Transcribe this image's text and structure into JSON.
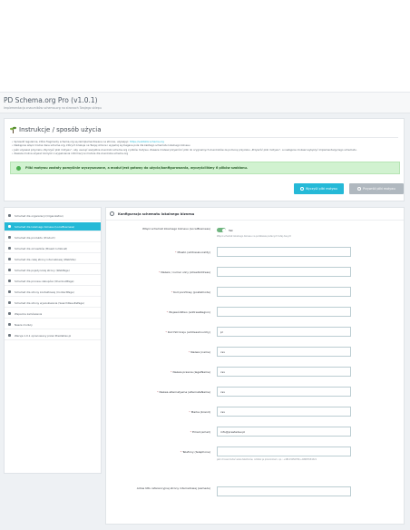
{
  "header": {
    "title": "PD Schema.org Pro (v1.0.1)",
    "subtitle": "Implementacja znaczników schema.org na stronach Twojego sklepu"
  },
  "instructions": {
    "title": "Instrukcje / sposób użycia",
    "items": [
      {
        "text": "Sprawdź regularnie, które fragmenty schema.org są zaimplementowane na stronie, używając: ",
        "link": "https://validator.schema.org"
      },
      {
        "text": "Następnie włącz można dane schema.org, których brakuje na Twojej stronie i wypełnij wymagane pola dla każdego schematu lokalnego biznesu",
        "link": ""
      },
      {
        "text": "Jeśli używasz przycisku „Wyczyść pliki motywu”, aby usunąć wszystkie znaczniki schema.org z plików motywu. Zawsze możesz przywrócić pliki do oryginalnych znaczników za pomocą przycisku „Przywróć pliki motywu”, a następnie możesz wyłączyć implementację tego schematu.",
        "link": ""
      },
      {
        "text": "Zawsze można używać korzyści z wypełnienia informacji w module dla znacznika schema.org",
        "link": ""
      }
    ]
  },
  "alert": {
    "text": "Pliki motywu zostały pomyślnie wyczyszczone, a moduł jest gotowy do użycia/konfigurowania, wyczyściliśmy 6 plików szablonu."
  },
  "buttons": {
    "clear": "Wyczyść pliki motywu",
    "restore": "Przywróć pliki motywu"
  },
  "sidebar": {
    "items": [
      {
        "label": "Schemat dla organizacji (Organization)",
        "active": false
      },
      {
        "label": "Schemat dla lokalnego biznesu (LocalBusiness)",
        "active": true
      },
      {
        "label": "Schemat dla produktu (Product)",
        "active": false
      },
      {
        "label": "Schemat dla okruszków (BreadcrumbList)",
        "active": false
      },
      {
        "label": "Schemat dla całej strony internetowej (WebSite)",
        "active": false
      },
      {
        "label": "Schemat dla pojedynczej strony (WebPage)",
        "active": false
      },
      {
        "label": "Schemat dla procesu zakupów (CheckoutPage)",
        "active": false
      },
      {
        "label": "Schemat dla strony kontaktowej (ContactPage)",
        "active": false
      },
      {
        "label": "Schemat dla strony wyszukiwania (SearchResultsPage)",
        "active": false
      },
      {
        "label": "Wsparcie zamówienia",
        "active": false
      },
      {
        "label": "Nasze moduły",
        "active": false
      },
      {
        "label": "Wersja 1.0.1 opracowany przez PrestaDev.pl",
        "active": false
      }
    ]
  },
  "form": {
    "title": "Konfiguracja schematu lokalnego biznesu",
    "switch": {
      "label": "Włącz schemat lokalnego biznesu (LocalBusiness)",
      "value": "Tak",
      "help": "Włącz schemat lokalnego biznesu na podstawie podanych tutaj danych"
    },
    "fields": [
      {
        "label": "Miasto (addressLocality)",
        "required": true,
        "value": ""
      },
      {
        "label": "Nazwa / numer ulicy (streetAddress)",
        "required": true,
        "value": ""
      },
      {
        "label": "Kod pocztowy (postalCode)",
        "required": true,
        "value": ""
      },
      {
        "label": "Województwo (addressRegion)",
        "required": true,
        "value": ""
      },
      {
        "label": "Kod ISO kraju (addressCountry)",
        "required": true,
        "value": "pl"
      },
      {
        "label": "Nazwa (name)",
        "required": true,
        "value": "csv"
      },
      {
        "label": "Nazwa prawna (legalName)",
        "required": true,
        "value": "csv"
      },
      {
        "label": "Nazwa alternatywna (alternateName)",
        "required": true,
        "value": "csv"
      },
      {
        "label": "Marka (brand)",
        "required": true,
        "value": "csv"
      },
      {
        "label": "Email (email)",
        "required": true,
        "value": "info@prestadev.pl"
      },
      {
        "label": "Telefony (telephone)",
        "required": true,
        "value": ""
      }
    ],
    "telephone_help": "jeśli chcesz dodać wiele telefonów, oddziel je przecinkiem, np.: +48123456789,+48987654321",
    "last_field": {
      "label": "Adres URL referencyjnej strony internetowej (sameAs)",
      "value": ""
    }
  }
}
